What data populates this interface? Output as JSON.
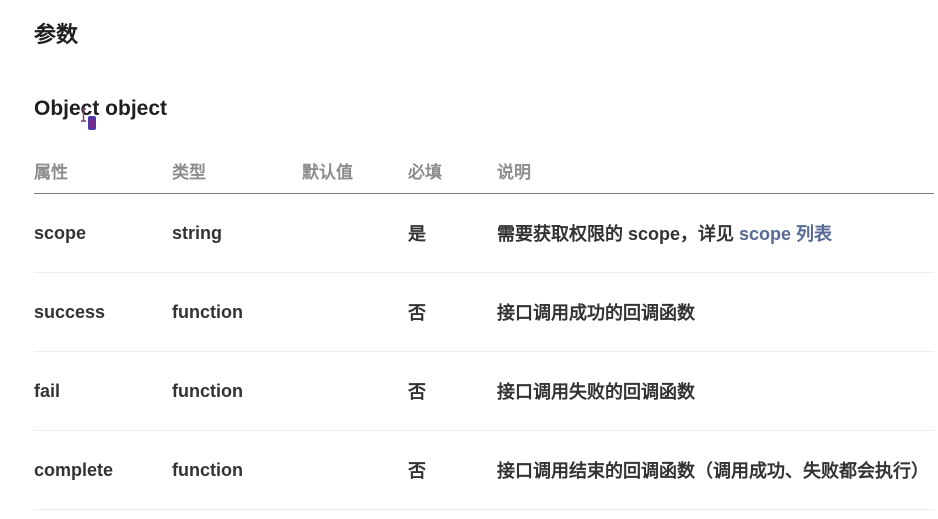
{
  "section_title": "参数",
  "object_title": "Object object",
  "table": {
    "headers": {
      "attr": "属性",
      "type": "类型",
      "default": "默认值",
      "required": "必填",
      "desc": "说明"
    },
    "rows": [
      {
        "attr": "scope",
        "type": "string",
        "default": "",
        "required": "是",
        "desc": "需要获取权限的 scope，详见 ",
        "link": "scope 列表"
      },
      {
        "attr": "success",
        "type": "function",
        "default": "",
        "required": "否",
        "desc": "接口调用成功的回调函数",
        "link": ""
      },
      {
        "attr": "fail",
        "type": "function",
        "default": "",
        "required": "否",
        "desc": "接口调用失败的回调函数",
        "link": ""
      },
      {
        "attr": "complete",
        "type": "function",
        "default": "",
        "required": "否",
        "desc": "接口调用结束的回调函数（调用成功、失败都会执行）",
        "link": ""
      }
    ]
  },
  "colors": {
    "link": "#576b95",
    "header_text": "#8c8c8c",
    "body_text": "#333333",
    "row_divider": "#ececec"
  },
  "icons": {
    "cursor": "text-cursor-with-lock-icon"
  }
}
